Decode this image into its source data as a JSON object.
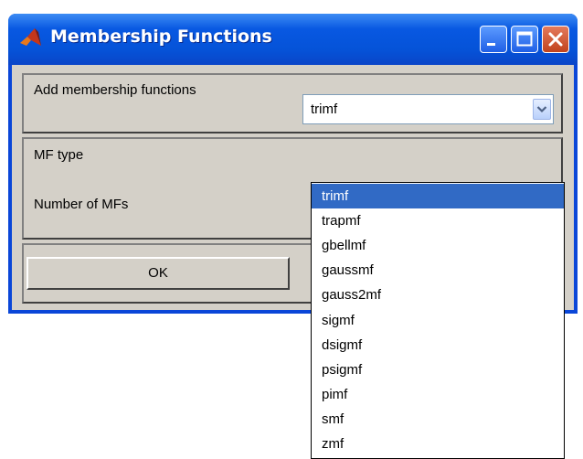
{
  "window": {
    "title": "Membership Functions",
    "colors": {
      "titlebar": "#0553d8",
      "client": "#d4d0c8",
      "selection": "#316ac5",
      "close_button": "#c1431d"
    }
  },
  "message": "Add membership functions",
  "form": {
    "mf_type_label": "MF type",
    "mf_type_value": "trimf",
    "num_mfs_label": "Number of MFs"
  },
  "buttons": {
    "ok": "OK"
  },
  "dropdown": {
    "selected_index": 0,
    "options": [
      "trimf",
      "trapmf",
      "gbellmf",
      "gaussmf",
      "gauss2mf",
      "sigmf",
      "dsigmf",
      "psigmf",
      "pimf",
      "smf",
      "zmf"
    ]
  },
  "icons": [
    "matlab-logo-icon",
    "minimize-icon",
    "maximize-icon",
    "close-icon",
    "chevron-down-icon"
  ]
}
